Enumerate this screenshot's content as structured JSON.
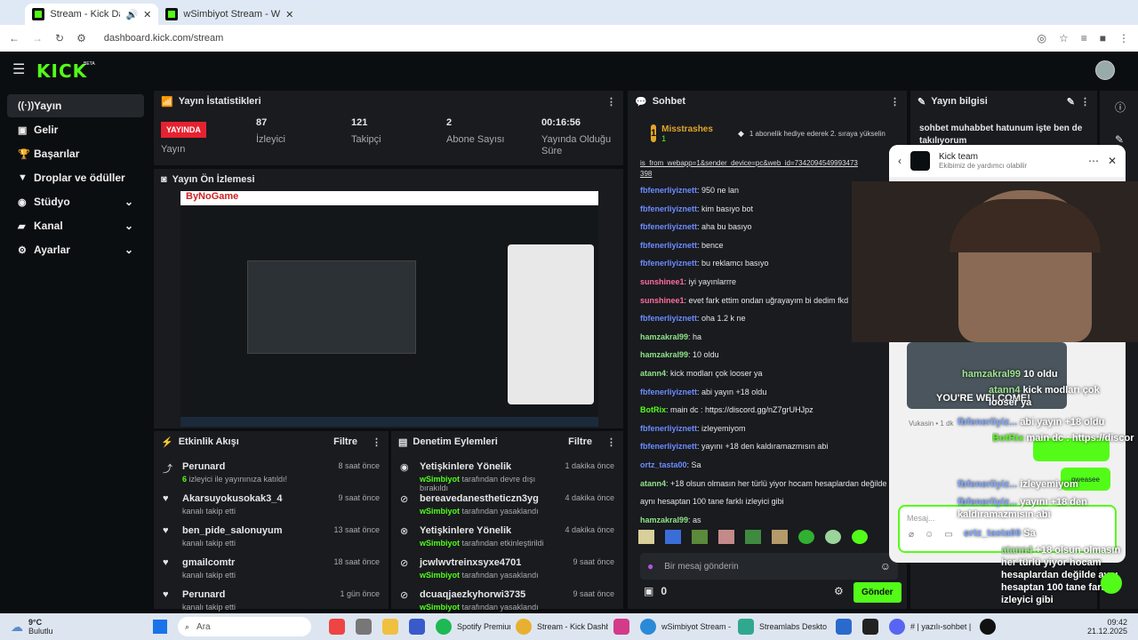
{
  "browser": {
    "tabs": [
      {
        "label": "Stream - Kick Dashboard",
        "active": true
      },
      {
        "label": "wSimbiyot Stream - Watch Live",
        "active": false
      }
    ],
    "url": "dashboard.kick.com/stream"
  },
  "app": {
    "logo": "KICK",
    "logo_badge": "BETA"
  },
  "sidebar": {
    "items": [
      {
        "icon": "broadcast-icon",
        "label": "Yayın",
        "active": true
      },
      {
        "icon": "income-icon",
        "label": "Gelir"
      },
      {
        "icon": "trophy-icon",
        "label": "Başarılar"
      },
      {
        "icon": "gift-icon",
        "label": "Droplar ve ödüller"
      },
      {
        "icon": "studio-icon",
        "label": "Stüdyo",
        "expandable": true
      },
      {
        "icon": "channel-icon",
        "label": "Kanal",
        "expandable": true
      },
      {
        "icon": "settings-icon",
        "label": "Ayarlar",
        "expandable": true
      }
    ]
  },
  "stats": {
    "title": "Yayın İstatistikleri",
    "live_badge": "YAYINDA",
    "live_label": "Yayın",
    "items": [
      {
        "value": "87",
        "label": "İzleyici"
      },
      {
        "value": "121",
        "label": "Takipçi"
      },
      {
        "value": "2",
        "label": "Abone Sayısı"
      },
      {
        "value": "00:16:56",
        "label": "Yayında Olduğu Süre"
      }
    ]
  },
  "preview": {
    "title": "Yayın Ön İzlemesi",
    "overlay_text": "ByNoGame"
  },
  "activity": {
    "title": "Etkinlik Akışı",
    "filter": "Filtre",
    "items": [
      {
        "icon": "raid-icon",
        "name": "Perunard",
        "prefix": "6",
        "sub": " izleyici ile yayınınıza katıldı!",
        "time": "8 saat önce"
      },
      {
        "icon": "heart-icon",
        "name": "Akarsuyokusokak3_4",
        "sub": "kanalı takip etti",
        "time": "9 saat önce"
      },
      {
        "icon": "heart-icon",
        "name": "ben_pide_salonuyum",
        "sub": "kanalı takip etti",
        "time": "13 saat önce"
      },
      {
        "icon": "heart-icon",
        "name": "gmailcomtr",
        "sub": "kanalı takip etti",
        "time": "18 saat önce"
      },
      {
        "icon": "heart-icon",
        "name": "Perunard",
        "sub": "kanalı takip etti",
        "time": "1 gün önce"
      }
    ]
  },
  "moderation": {
    "title": "Denetim Eylemleri",
    "filter": "Filtre",
    "items": [
      {
        "icon": "eye-icon",
        "name": "Yetişkinlere Yönelik",
        "by": "wSimbiyot",
        "sub": " tarafından devre dışı bırakıldı",
        "time": "1 dakika önce"
      },
      {
        "icon": "ban-icon",
        "name": "bereavedanestheticzn3yg",
        "by": "wSimbiyot",
        "sub": " tarafından yasaklandı",
        "time": "4 dakika önce"
      },
      {
        "icon": "eye-off-icon",
        "name": "Yetişkinlere Yönelik",
        "by": "wSimbiyot",
        "sub": " tarafından etkinleştirildi",
        "time": "4 dakika önce"
      },
      {
        "icon": "ban-icon",
        "name": "jcwlwvtreinxsyxe4701",
        "by": "wSimbiyot",
        "sub": " tarafından yasaklandı",
        "time": "9 saat önce"
      },
      {
        "icon": "ban-icon",
        "name": "dcuaqjaezkyhorwi3735",
        "by": "wSimbiyot",
        "sub": " tarafından yasaklandı",
        "time": "9 saat önce"
      }
    ]
  },
  "chat": {
    "title": "Sohbet",
    "pinned_user": "Misstrashes",
    "pinned_rank": "1",
    "pinned_count": "1",
    "pinned_note": "1 abonelik hediye ederek 2. sıraya yükselin",
    "url_fragment": "is_from_webapp=1&sender_device=pc&web_id=7342094549993473",
    "url_end": "398",
    "messages": [
      {
        "user": "fbfenerliyiznett",
        "color": "#6c8cff",
        "text": ": 950 ne lan"
      },
      {
        "user": "fbfenerliyiznett",
        "color": "#6c8cff",
        "text": ": kim basıyo bot"
      },
      {
        "user": "fbfenerliyiznett",
        "color": "#6c8cff",
        "text": ": aha bu basıyo"
      },
      {
        "user": "fbfenerliyiznett",
        "color": "#6c8cff",
        "text": ": bence"
      },
      {
        "user": "fbfenerliyiznett",
        "color": "#6c8cff",
        "text": ": bu reklamcı basıyo"
      },
      {
        "user": "sunshinee1",
        "color": "#ff6c9c",
        "text": ": iyi yayınlarrre"
      },
      {
        "user": "sunshinee1",
        "color": "#ff6c9c",
        "text": ": evet fark ettim ondan uğrayayım bi dedim fkd"
      },
      {
        "user": "fbfenerliyiznett",
        "color": "#6c8cff",
        "text": ": oha 1.2 k ne"
      },
      {
        "user": "hamzakral99",
        "color": "#8fe388",
        "text": ": ha"
      },
      {
        "user": "hamzakral99",
        "color": "#8fe388",
        "text": ": 10 oldu"
      },
      {
        "user": "atann4",
        "color": "#8fe388",
        "text": ": kick modları çok looser ya"
      },
      {
        "user": "fbfenerliyiznett",
        "color": "#6c8cff",
        "text": ": abi yayın +18 oldu"
      },
      {
        "user": "BotRix",
        "color": "#53fc18",
        "text": ": main dc : ",
        "link": "https://discord.gg/nZ7grUHJpz"
      },
      {
        "user": "fbfenerliyiznett",
        "color": "#6c8cff",
        "text": ": izleyemiyom"
      },
      {
        "user": "fbfenerliyiznett",
        "color": "#6c8cff",
        "text": ": yayını +18 den kaldıramazmısın abi"
      },
      {
        "user": "ortz_tasta00",
        "color": "#6c8cff",
        "text": ": Sa"
      },
      {
        "user": "atann4",
        "color": "#8fe388",
        "text": ": +18 olsun olmasın her türlü yiyor hocam hesaplardan değilde"
      },
      {
        "user": "",
        "color": "#eee",
        "text": "aynı hesaptan 100 tane farklı izleyici gibi"
      },
      {
        "user": "hamzakral99",
        "color": "#8fe388",
        "text": ": as"
      }
    ],
    "input_placeholder": "Bir mesaj gönderin",
    "points": "0",
    "send": "Gönder"
  },
  "info": {
    "title": "Yayın bilgisi",
    "stream_title": "sohbet muhabbet hatunum işte ben de takılıyorum"
  },
  "kick_popup": {
    "name": "Kick team",
    "subtitle": "Ekibimiz de yardımcı olabilir",
    "timestamp": "Vukasin • 1 dk",
    "input_placeholder": "Mesaj..."
  },
  "stream_overlay": {
    "welcome": "YOU'RE WELCOME!",
    "chat": [
      {
        "user": "hamzakral99",
        "text": "10 oldu"
      },
      {
        "user": "atann4",
        "text": "kick modları çok looser ya"
      },
      {
        "user": "fbfenerliyiz...",
        "text": "abi yayın +18 oldu"
      },
      {
        "user": "BotRix",
        "text": "main dc : https://discord.gg/nZ7grUHJpz"
      },
      {
        "user": "fbfenerliyiz...",
        "text": "izleyemiyom"
      },
      {
        "user": "fbfenerliyiz...",
        "text": "yayını +18 den kaldıramazmısın abi"
      },
      {
        "user": "ortz_tasta00",
        "text": "Sa"
      },
      {
        "user": "atann4",
        "text": "+18 olsun olmasın her türlü yiyor hocam hesaplardan değilde aynı hesaptan 100 tane farklı izleyici gibi"
      },
      {
        "user": "hamzakral99",
        "text": "as"
      }
    ],
    "bubble": "pweasee"
  },
  "taskbar": {
    "weather_temp": "9°C",
    "weather_text": "Bulutlu",
    "search": "Ara",
    "apps": [
      "Spotify Premium",
      "Stream - Kick Dashb",
      "wSimbiyot Stream - '",
      "Streamlabs Deskto",
      "# | yazılı-sohbet |"
    ],
    "time": "09:42",
    "date": "21.12.2025"
  }
}
